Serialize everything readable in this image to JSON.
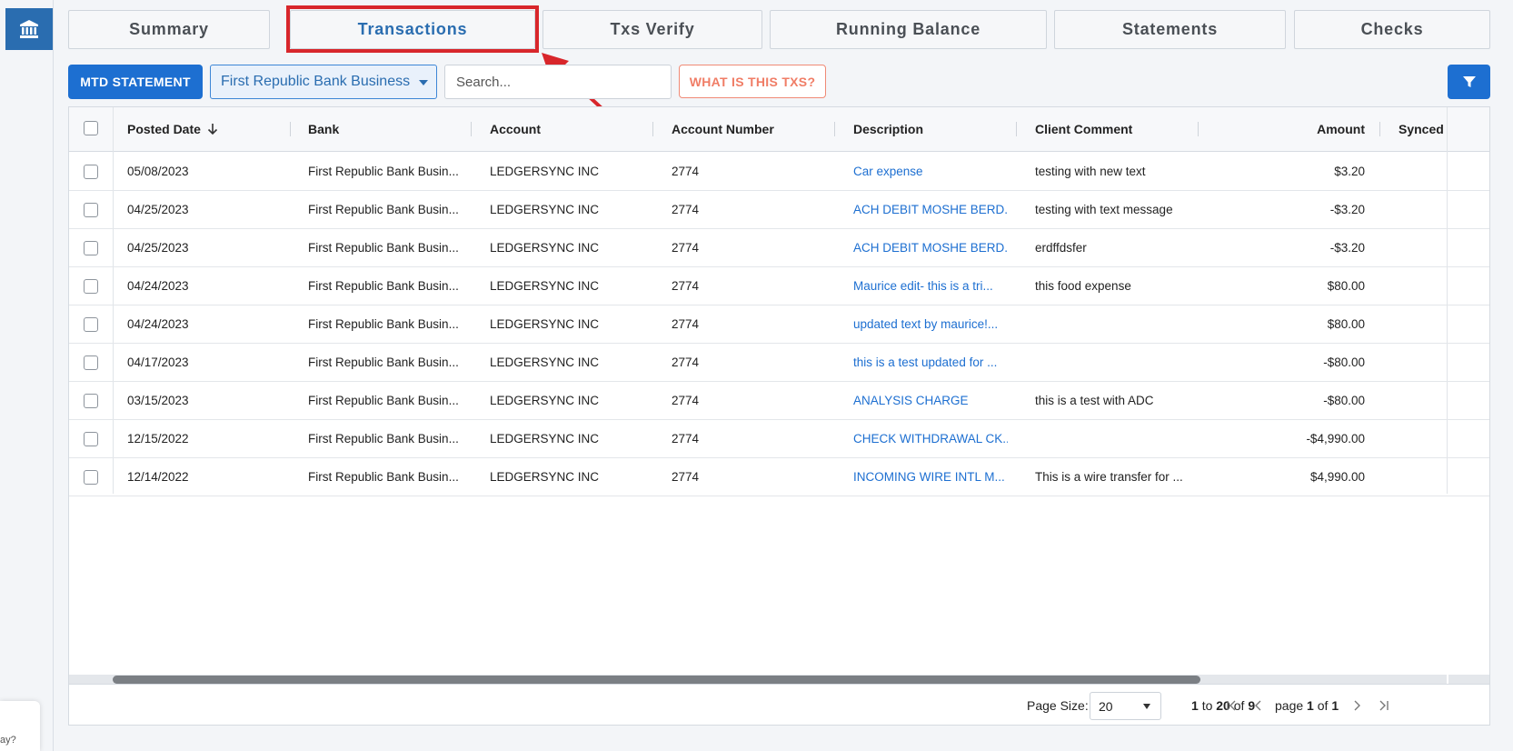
{
  "tabs": [
    {
      "label": "Summary"
    },
    {
      "label": "Transactions"
    },
    {
      "label": "Txs Verify"
    },
    {
      "label": "Running Balance"
    },
    {
      "label": "Statements"
    },
    {
      "label": "Checks"
    }
  ],
  "active_tab": "Transactions",
  "toolbar": {
    "mtd_label": "MTD STATEMENT",
    "bank_selected": "First Republic Bank Business",
    "search_placeholder": "Search...",
    "what_label": "WHAT IS THIS TXS?"
  },
  "grid": {
    "columns": [
      "Posted Date",
      "Bank",
      "Account",
      "Account Number",
      "Description",
      "Client Comment",
      "Amount",
      "Synced I"
    ],
    "sort": {
      "column": "Posted Date",
      "direction": "desc"
    },
    "rows": [
      {
        "date": "05/08/2023",
        "bank": "First Republic Bank Busin...",
        "account": "LEDGERSYNC INC",
        "number": "2774",
        "description": "Car expense",
        "comment": "testing with new text",
        "amount": "$3.20"
      },
      {
        "date": "04/25/2023",
        "bank": "First Republic Bank Busin...",
        "account": "LEDGERSYNC INC",
        "number": "2774",
        "description": "ACH DEBIT MOSHE BERD...",
        "comment": "testing with text message",
        "amount": "-$3.20"
      },
      {
        "date": "04/25/2023",
        "bank": "First Republic Bank Busin...",
        "account": "LEDGERSYNC INC",
        "number": "2774",
        "description": "ACH DEBIT MOSHE BERD...",
        "comment": "erdffdsfer",
        "amount": "-$3.20"
      },
      {
        "date": "04/24/2023",
        "bank": "First Republic Bank Busin...",
        "account": "LEDGERSYNC INC",
        "number": "2774",
        "description": "Maurice edit- this is a tri...",
        "comment": "this food expense",
        "amount": "$80.00"
      },
      {
        "date": "04/24/2023",
        "bank": "First Republic Bank Busin...",
        "account": "LEDGERSYNC INC",
        "number": "2774",
        "description": "updated text by maurice!...",
        "comment": "",
        "amount": "$80.00"
      },
      {
        "date": "04/17/2023",
        "bank": "First Republic Bank Busin...",
        "account": "LEDGERSYNC INC",
        "number": "2774",
        "description": "this is a test updated for ...",
        "comment": "",
        "amount": "-$80.00"
      },
      {
        "date": "03/15/2023",
        "bank": "First Republic Bank Busin...",
        "account": "LEDGERSYNC INC",
        "number": "2774",
        "description": "ANALYSIS CHARGE",
        "comment": "this is a test with ADC",
        "amount": "-$80.00"
      },
      {
        "date": "12/15/2022",
        "bank": "First Republic Bank Busin...",
        "account": "LEDGERSYNC INC",
        "number": "2774",
        "description": "CHECK WITHDRAWAL CK...",
        "comment": "",
        "amount": "-$4,990.00"
      },
      {
        "date": "12/14/2022",
        "bank": "First Republic Bank Busin...",
        "account": "LEDGERSYNC INC",
        "number": "2774",
        "description": "INCOMING WIRE INTL M...",
        "comment": "This is a wire transfer for ...",
        "amount": "$4,990.00"
      }
    ]
  },
  "pagination": {
    "page_size_label": "Page Size:",
    "page_size": "20",
    "range_from": "1",
    "range_to_word": "to",
    "range_to": "20",
    "of_word": "of",
    "total": "9",
    "page_word": "page",
    "page": "1",
    "page_of_word": "of",
    "pages": "1"
  },
  "popup_text": "ay?",
  "colors": {
    "brand_blue": "#1d6fd1",
    "link_blue": "#1d6fd1",
    "annotation_red": "#d8262b",
    "warning_orange": "#f07d66"
  }
}
